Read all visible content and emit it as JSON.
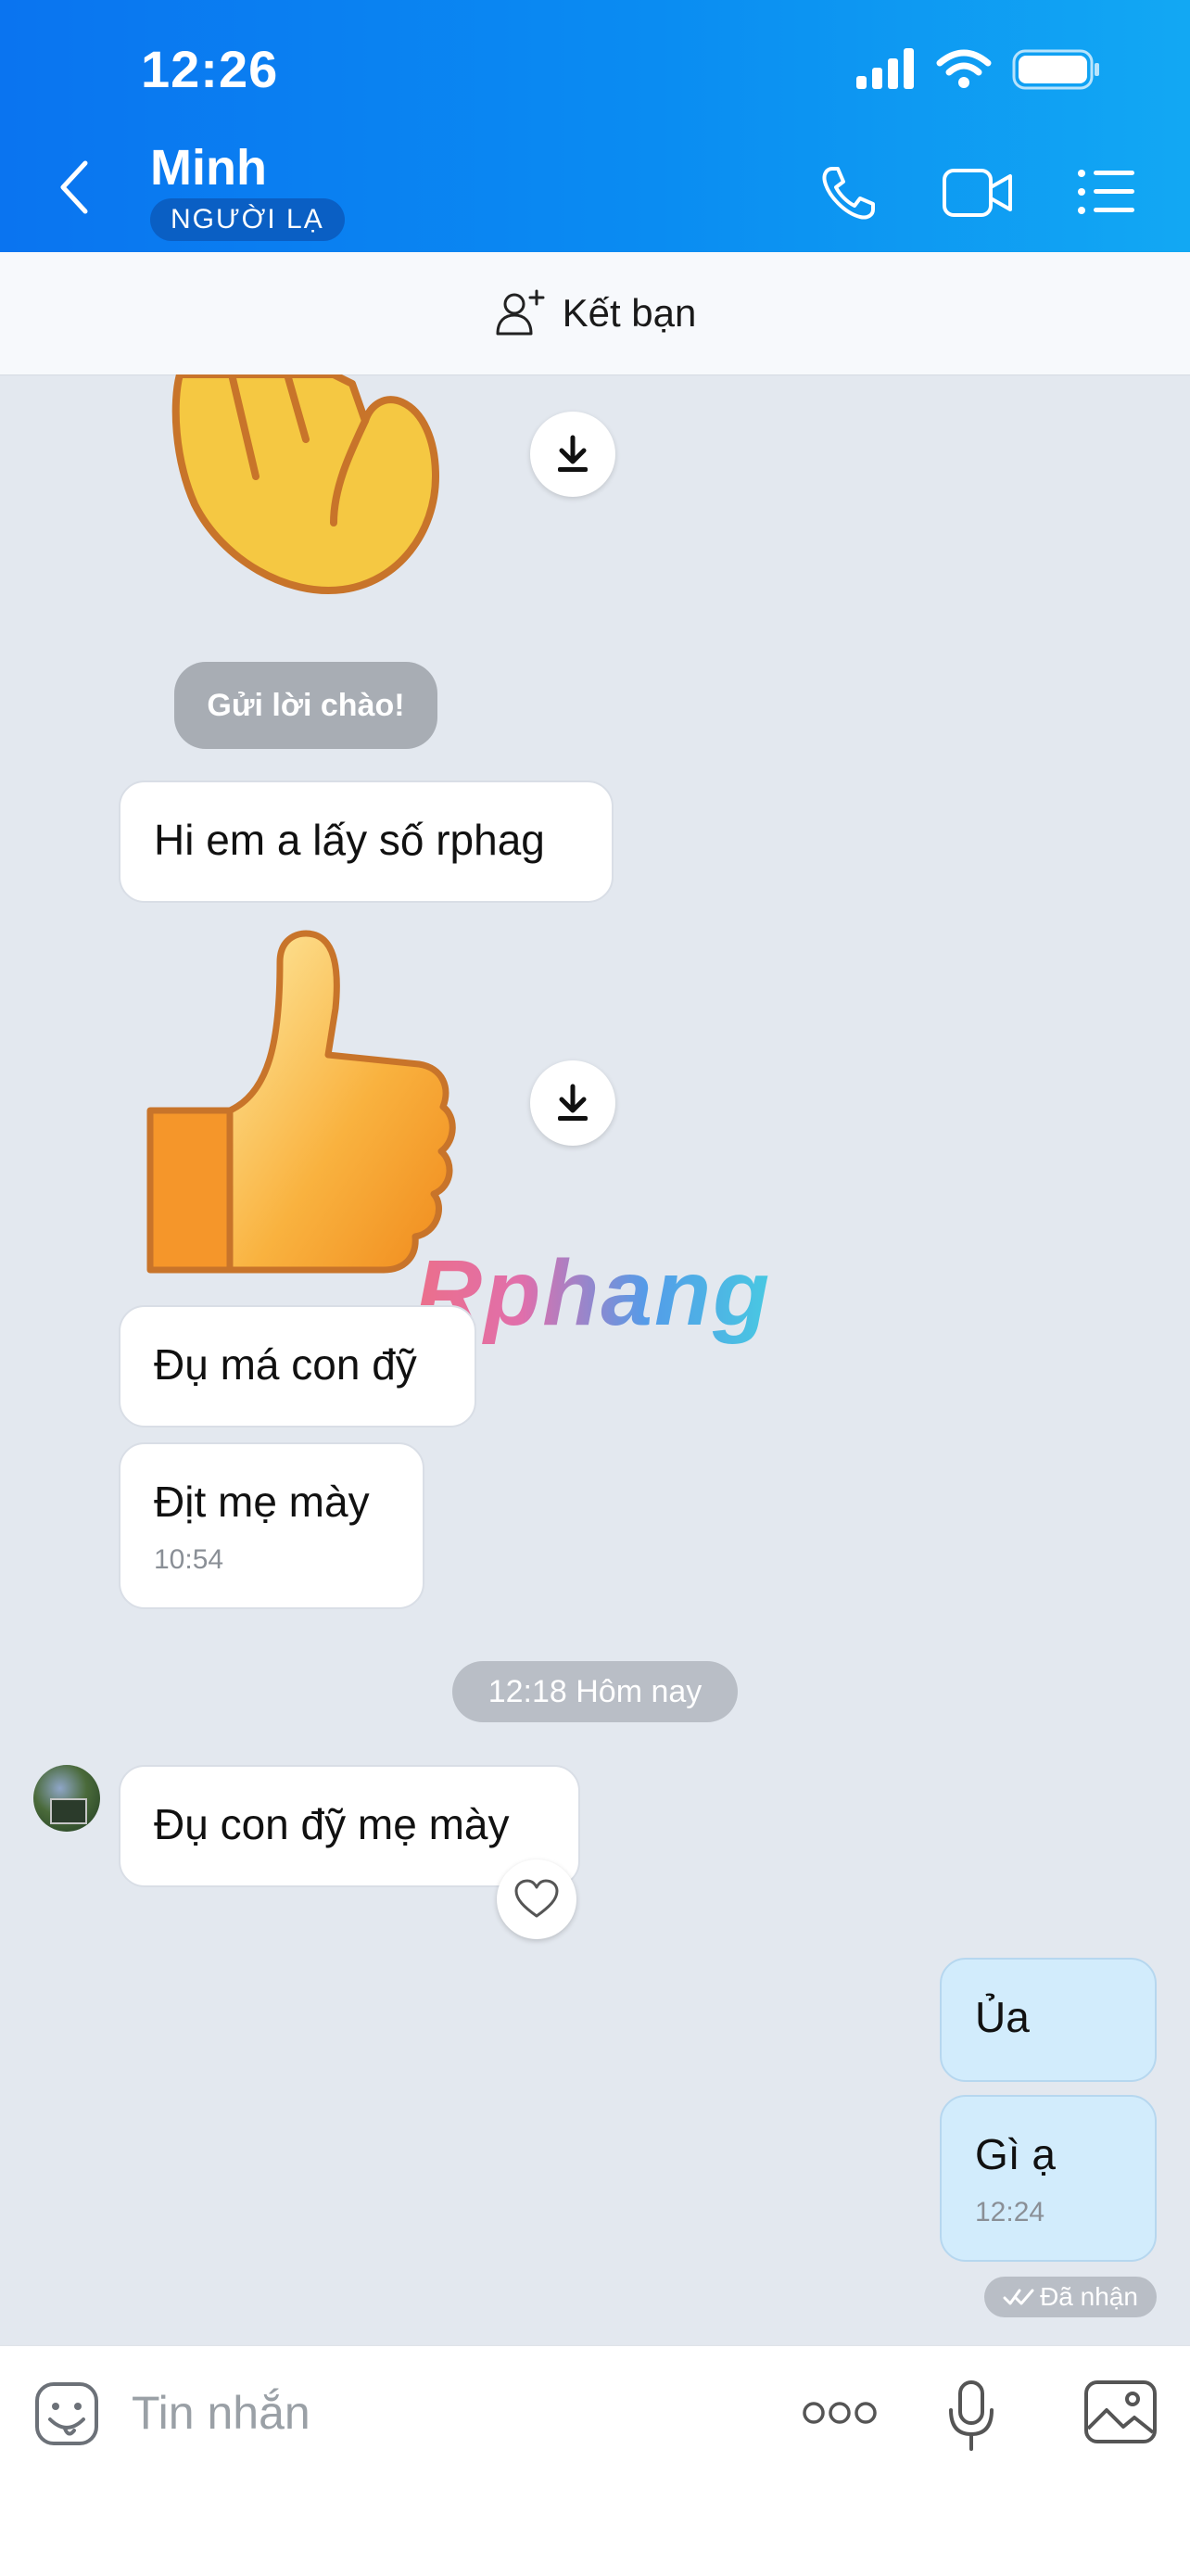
{
  "status_bar": {
    "time": "12:26"
  },
  "header": {
    "contact_name": "Minh",
    "stranger_badge": "NGƯỜI LẠ"
  },
  "friend_bar": {
    "label": "Kết bạn"
  },
  "chat": {
    "greeting_button": "Gửi lời chào!",
    "messages": [
      {
        "text": "Hi em a lấy số rphag"
      },
      {
        "text": "Đụ má con đỹ"
      },
      {
        "text": "Địt mẹ mày",
        "time": "10:54"
      },
      {
        "text": "Đụ con đỹ mẹ mày"
      },
      {
        "text": "Ủa"
      },
      {
        "text": "Gì ạ",
        "time": "12:24"
      }
    ],
    "date_separator": "12:18 Hôm nay",
    "delivery_status": "Đã nhận",
    "watermark": "Rphang"
  },
  "composer": {
    "placeholder": "Tin nhắn"
  },
  "colors": {
    "header_blue": "#0a74f0",
    "bubble_me": "#d2ecfc",
    "chat_bg": "#e3e8ef"
  }
}
